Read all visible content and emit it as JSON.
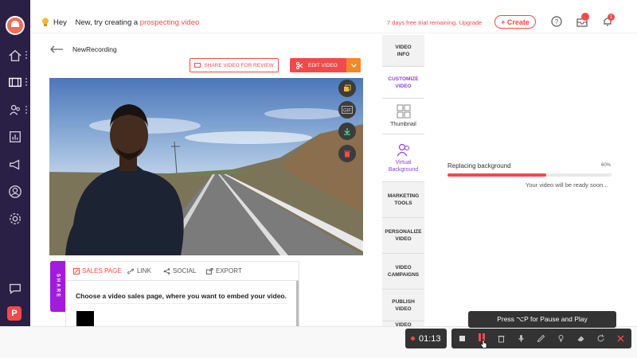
{
  "header": {
    "greeting_prefix": "Hey",
    "greeting_name": "New",
    "greeting_middle": ", try creating a",
    "greeting_link": "prospecting video",
    "trial_text": "7 days free trial remaining. Upgrade",
    "create_label": "+ Create",
    "notification_count": "1"
  },
  "sidebar": {
    "badge_letter": "P",
    "items": [
      "home",
      "videos",
      "contacts",
      "analytics",
      "campaigns",
      "profile",
      "settings",
      "chat"
    ]
  },
  "recording": {
    "title": "NewRecording",
    "share_button": "SHARE VIDEO FOR REVIEW",
    "edit_button": "EDIT VIDEO",
    "video_controls": [
      "copy",
      "GIF",
      "download",
      "delete"
    ]
  },
  "share_panel": {
    "tag": "SHARE",
    "tabs": [
      {
        "label": "SALES PAGE"
      },
      {
        "label": "LINK"
      },
      {
        "label": "SOCIAL"
      },
      {
        "label": "EXPORT"
      }
    ],
    "description": "Choose a video sales page, where you want to embed your video."
  },
  "side_tabs": [
    {
      "label": "VIDEO INFO"
    },
    {
      "label": "CUSTOMIZE VIDEO"
    },
    {
      "label": "Thumbnail"
    },
    {
      "label": "Virtual Background"
    },
    {
      "label": "MARKETING TOOLS"
    },
    {
      "label": "PERSONALIZE VIDEO"
    },
    {
      "label": "VIDEO CAMPAIGNS"
    },
    {
      "label": "PUBLISH VIDEO"
    },
    {
      "label": "VIDEO"
    }
  ],
  "processing": {
    "label": "Replacing background",
    "percent_text": "60%",
    "progress": 0.6,
    "note": "Your video will be ready soon..."
  },
  "recorder": {
    "tooltip": "Press ⌥P for Pause and Play",
    "timer": "01:13",
    "controls": [
      "stop",
      "pause",
      "delete",
      "mic",
      "pen",
      "highlight",
      "eraser",
      "redo",
      "close"
    ]
  },
  "colors": {
    "accent": "#ef4b4b",
    "sidebar": "#2a1f45",
    "purple": "#8e3fd6"
  }
}
